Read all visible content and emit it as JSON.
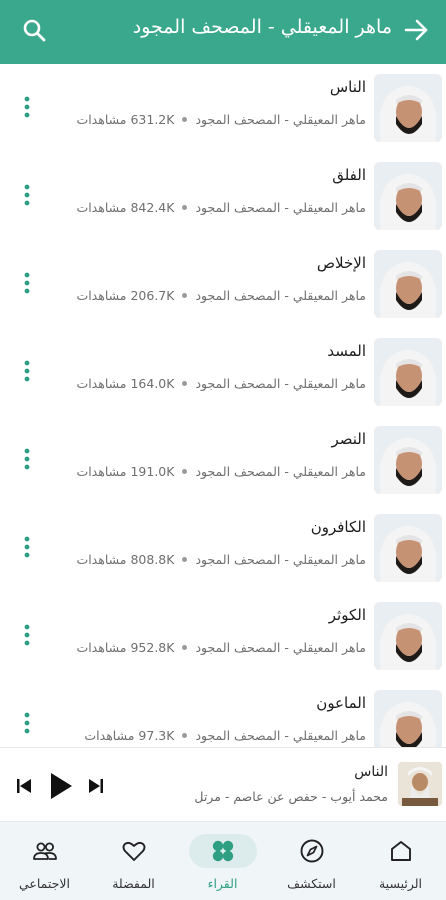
{
  "appbar": {
    "title": "ماهر المعيقلي - المصحف المجود",
    "back_icon": "arrow-back-icon",
    "search_icon": "search-icon"
  },
  "tracks": [
    {
      "title": "الناس",
      "subtitle": "ماهر المعيقلي - المصحف المجود",
      "views": "631.2K مشاهدات"
    },
    {
      "title": "الفلق",
      "subtitle": "ماهر المعيقلي - المصحف المجود",
      "views": "842.4K مشاهدات"
    },
    {
      "title": "الإخلاص",
      "subtitle": "ماهر المعيقلي - المصحف المجود",
      "views": "206.7K مشاهدات"
    },
    {
      "title": "المسد",
      "subtitle": "ماهر المعيقلي - المصحف المجود",
      "views": "164.0K مشاهدات"
    },
    {
      "title": "النصر",
      "subtitle": "ماهر المعيقلي - المصحف المجود",
      "views": "191.0K مشاهدات"
    },
    {
      "title": "الكافرون",
      "subtitle": "ماهر المعيقلي - المصحف المجود",
      "views": "808.8K مشاهدات"
    },
    {
      "title": "الكوثر",
      "subtitle": "ماهر المعيقلي - المصحف المجود",
      "views": "952.8K مشاهدات"
    },
    {
      "title": "الماعون",
      "subtitle": "ماهر المعيقلي - المصحف المجود",
      "views": "97.3K مشاهدات"
    }
  ],
  "player": {
    "title": "الناس",
    "subtitle": "محمد أيوب - حفص عن عاصم - مرتل",
    "controls": [
      "skip-previous-icon",
      "play-icon",
      "skip-next-icon"
    ]
  },
  "nav": {
    "items": [
      {
        "label": "الرئيسية",
        "icon": "home-icon",
        "active": false
      },
      {
        "label": "استكشف",
        "icon": "compass-icon",
        "active": false
      },
      {
        "label": "القراء",
        "icon": "reciters-grid-icon",
        "active": true
      },
      {
        "label": "المفضلة",
        "icon": "heart-icon",
        "active": false
      },
      {
        "label": "الاجتماعي",
        "icon": "people-icon",
        "active": false
      }
    ]
  },
  "colors": {
    "primary": "#3aa88d",
    "accent_dots": "#2f9f83",
    "nav_background": "#f0f5f8",
    "active_pill": "#dcebeb"
  }
}
